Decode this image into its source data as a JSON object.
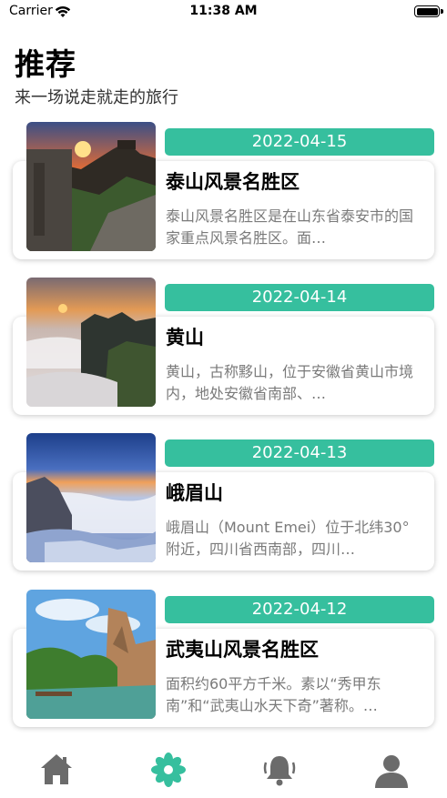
{
  "status_bar": {
    "carrier": "Carrier",
    "time": "11:38 AM"
  },
  "header": {
    "title": "推荐",
    "subtitle": "来一场说走就走的旅行"
  },
  "cards": [
    {
      "date": "2022-04-15",
      "title": "泰山风景名胜区",
      "description": "泰山风景名胜区是在山东省泰安市的国家重点风景名胜区。面…"
    },
    {
      "date": "2022-04-14",
      "title": "黄山",
      "description": "黄山，古称黟山，位于安徽省黄山市境内，地处安徽省南部、…"
    },
    {
      "date": "2022-04-13",
      "title": "峨眉山",
      "description": "峨眉山（Mount Emei）位于北纬30°附近，四川省西南部，四川…"
    },
    {
      "date": "2022-04-12",
      "title": "武夷山风景名胜区",
      "description": "面积约60平方千米。素以“秀甲东南”和“武夷山水天下奇”著称。…"
    }
  ],
  "tab_bar": {
    "active_index": 1,
    "items": [
      {
        "icon": "home-icon"
      },
      {
        "icon": "flower-icon"
      },
      {
        "icon": "bell-icon"
      },
      {
        "icon": "profile-icon"
      }
    ]
  },
  "colors": {
    "accent": "#36bf9e",
    "tab_inactive": "#6b6b6b",
    "description_text": "#7a7a7a"
  }
}
